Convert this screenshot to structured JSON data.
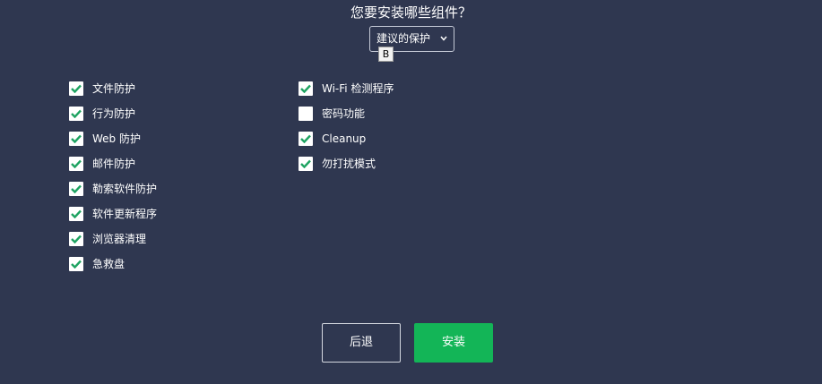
{
  "title": "您要安装哪些组件？",
  "preset_select": {
    "value": "建议的保护"
  },
  "tooltip": "B",
  "colors": {
    "background": "#2f3750",
    "accent": "#13b557",
    "check": "#1ea361"
  },
  "left_column": [
    {
      "label": "文件防护",
      "checked": true
    },
    {
      "label": "行为防护",
      "checked": true
    },
    {
      "label": "Web 防护",
      "checked": true
    },
    {
      "label": "邮件防护",
      "checked": true
    },
    {
      "label": "勒索软件防护",
      "checked": true
    },
    {
      "label": "软件更新程序",
      "checked": true
    },
    {
      "label": "浏览器清理",
      "checked": true
    },
    {
      "label": "急救盘",
      "checked": true
    }
  ],
  "right_column": [
    {
      "label": "Wi-Fi 检测程序",
      "checked": true
    },
    {
      "label": "密码功能",
      "checked": false
    },
    {
      "label": "Cleanup",
      "checked": true
    },
    {
      "label": "勿打扰模式",
      "checked": true
    }
  ],
  "buttons": {
    "back": "后退",
    "install": "安装"
  }
}
